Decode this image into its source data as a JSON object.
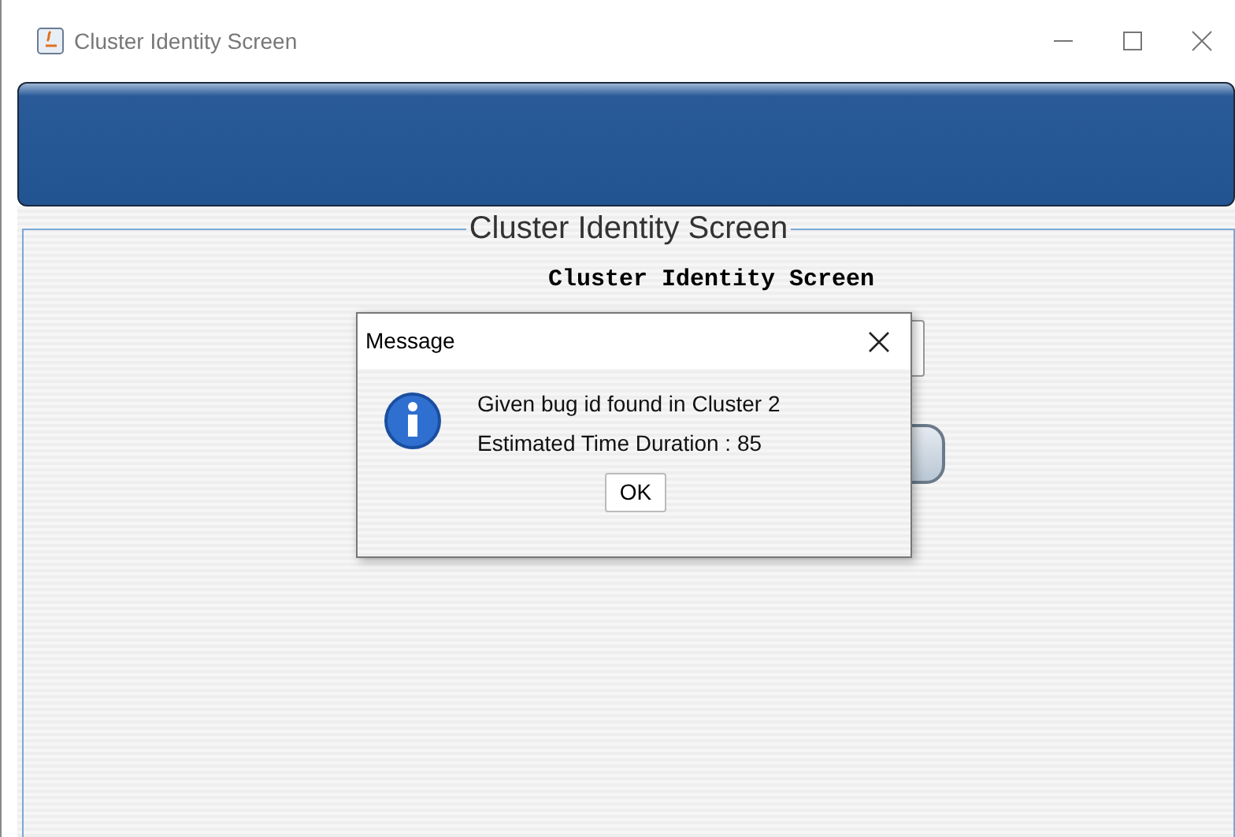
{
  "window": {
    "title": "Cluster Identity Screen"
  },
  "panel": {
    "legend": "Cluster Identity Screen",
    "heading": "Cluster Identity Screen"
  },
  "dialog": {
    "title": "Message",
    "lines": [
      "Given bug id found in Cluster 2",
      "Estimated Time Duration : 85"
    ],
    "button": "OK"
  }
}
